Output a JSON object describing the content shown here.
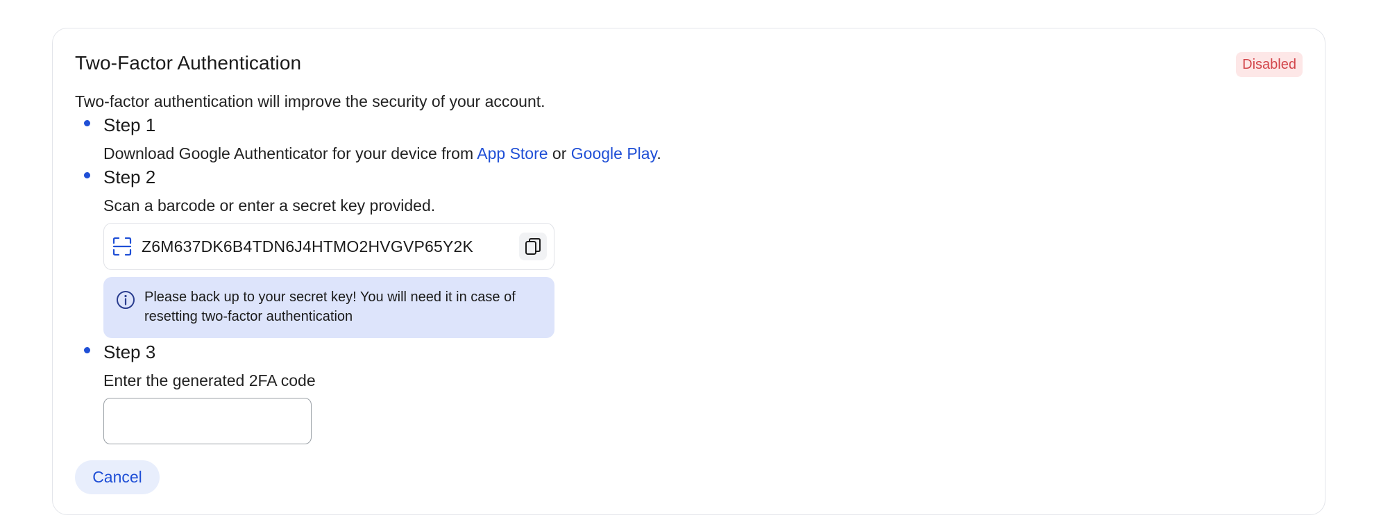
{
  "card": {
    "title": "Two-Factor Authentication",
    "status_badge": "Disabled",
    "description": "Two-factor authentication will improve the security of your account."
  },
  "steps": [
    {
      "title": "Step 1",
      "text_prefix": "Download Google Authenticator for your device from ",
      "link1": "App Store",
      "text_mid": " or ",
      "link2": "Google Play",
      "text_suffix": "."
    },
    {
      "title": "Step 2",
      "text": "Scan a barcode or enter a secret key provided.",
      "secret_key": "Z6M637DK6B4TDN6J4HTMO2HVGVP65Y2K",
      "alert": "Please back up to your secret key! You will need it in case of resetting two-factor authentication"
    },
    {
      "title": "Step 3",
      "text": "Enter the generated 2FA code",
      "code_value": ""
    }
  ],
  "actions": {
    "cancel_label": "Cancel"
  },
  "icons": {
    "scan": "scan-icon",
    "copy": "copy-icon",
    "info": "info-icon"
  },
  "colors": {
    "accent": "#1f4fd6",
    "badge_bg": "#fde7e7",
    "badge_text": "#d2454a",
    "alert_bg": "#dde4fb"
  }
}
